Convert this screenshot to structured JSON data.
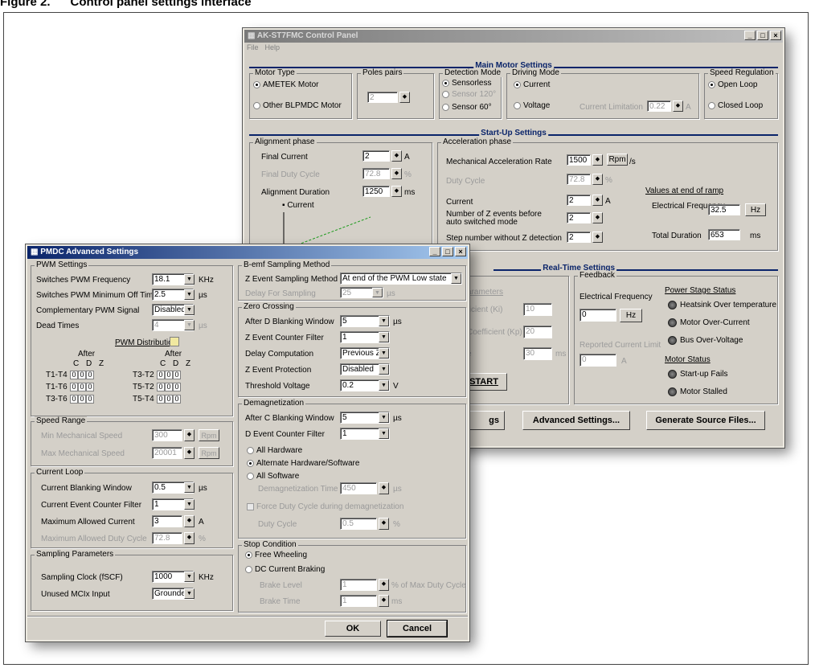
{
  "figure": {
    "caption": "Figure 2.      Control panel settings interface"
  },
  "cp": {
    "title": "AK-ST7FMC Control Panel",
    "menu": [
      "File",
      "Help"
    ],
    "main": {
      "title": "Main Motor Settings",
      "motor_type": {
        "legend": "Motor Type",
        "opt1": "AMETEK Motor",
        "opt2": "Other BLPMDC Motor"
      },
      "poles": {
        "legend": "Poles pairs",
        "value": "2"
      },
      "detection": {
        "legend": "Detection Mode",
        "opt1": "Sensorless",
        "opt2": "Sensor 120°",
        "opt3": "Sensor 60°"
      },
      "driving": {
        "legend": "Driving Mode",
        "opt1": "Current",
        "opt2": "Voltage",
        "limit_label": "Current Limitation",
        "limit_value": "0.22",
        "limit_unit": "A"
      },
      "speed": {
        "legend": "Speed Regulation",
        "opt1": "Open Loop",
        "opt2": "Closed Loop"
      }
    },
    "startup": {
      "title": "Start-Up Settings",
      "align": {
        "legend": "Alignment phase",
        "final_current_label": "Final Current",
        "final_current_value": "2",
        "final_current_unit": "A",
        "final_duty_label": "Final Duty Cycle",
        "final_duty_value": "72.8",
        "final_duty_unit": "%",
        "duration_label": "Alignment Duration",
        "duration_value": "1250",
        "duration_unit": "ms",
        "graph_label": "Current"
      },
      "accel": {
        "legend": "Acceleration phase",
        "rate_label": "Mechanical Acceleration Rate",
        "rate_value": "1500",
        "rate_unit_btn": "Rpm",
        "rate_unit_suffix": "/s",
        "duty_label": "Duty Cycle",
        "duty_value": "72.8",
        "duty_unit": "%",
        "current_label": "Current",
        "current_value": "2",
        "current_unit": "A",
        "z_events_label": "Number of Z events before auto switched mode",
        "z_events_value": "2",
        "step_label": "Step number without Z detection",
        "step_value": "2",
        "end_title": "Values at end of ramp",
        "freq_label": "Electrical Frequency",
        "freq_value": "32.5",
        "freq_unit": "Hz",
        "dur_label": "Total Duration",
        "dur_value": "653",
        "dur_unit": "ms"
      }
    },
    "realtime": {
      "title": "Real-Time Settings",
      "params_label": "arameters",
      "ki_label": "ficient (Ki)",
      "ki_value": "10",
      "kp_label": "Coefficient (Kp)",
      "kp_value": "20",
      "x_label": "e",
      "x_value": "30",
      "x_unit": "ms",
      "start": "START",
      "feedback": {
        "legend": "Feedback",
        "freq_label": "Electrical Frequency",
        "freq_value": "0",
        "freq_unit": "Hz",
        "limit_label": "Reported Current Limit",
        "limit_value": "0",
        "limit_unit": "A",
        "ps_title": "Power Stage Status",
        "ps": [
          "Heatsink Over temperature",
          "Motor Over-Current",
          "Bus Over-Voltage"
        ],
        "ms_title": "Motor Status",
        "ms": [
          "Start-up Fails",
          "Motor Stalled"
        ]
      }
    },
    "buttons": [
      "gs",
      "Advanced Settings...",
      "Generate Source Files..."
    ]
  },
  "adv": {
    "title": "PMDC Advanced Settings",
    "pwm": {
      "legend": "PWM Settings",
      "freq_label": "Switches PWM Frequency",
      "freq_value": "18.1",
      "freq_unit": "KHz",
      "offtime_label": "Switches PWM Minimum Off Time",
      "offtime_value": "2.5",
      "offtime_unit": "µs",
      "comp_label": "Complementary PWM Signal",
      "comp_value": "Disabled",
      "dead_label": "Dead Times",
      "dead_value": "4",
      "dead_unit": "µs",
      "dist_title": "PWM Distribution",
      "after": "After",
      "cdz": "C D Z",
      "rows_left": [
        "T1-T4",
        "T1-T6",
        "T3-T6"
      ],
      "rows_right": [
        "T3-T2",
        "T5-T2",
        "T5-T4"
      ]
    },
    "speed": {
      "legend": "Speed Range",
      "min_label": "Min Mechanical Speed",
      "min_value": "300",
      "max_label": "Max Mechanical Speed",
      "max_value": "20001",
      "unit": "Rpm"
    },
    "cloop": {
      "legend": "Current Loop",
      "blank_label": "Current Blanking Window",
      "blank_value": "0.5",
      "blank_unit": "µs",
      "filter_label": "Current Event Counter Filter",
      "filter_value": "1",
      "max_label": "Maximum Allowed Current",
      "max_value": "3",
      "max_unit": "A",
      "duty_label": "Maximum Allowed Duty Cycle",
      "duty_value": "72.8",
      "duty_unit": "%"
    },
    "sampling": {
      "legend": "Sampling Parameters",
      "clock_label": "Sampling Clock (fSCF)",
      "clock_value": "1000",
      "clock_unit": "KHz",
      "mcix_label": "Unused MCIx Input",
      "mcix_value": "Grounded"
    },
    "bemf": {
      "legend": "B-emf Sampling Method",
      "method_label": "Z Event Sampling Method",
      "method_value": "At end of the PWM Low state",
      "delay_label": "Delay For Sampling",
      "delay_value": "25",
      "delay_unit": "µs"
    },
    "zc": {
      "legend": "Zero Crossing",
      "blank_label": "After D Blanking Window",
      "blank_value": "5",
      "blank_unit": "µs",
      "filter_label": "Z Event Counter Filter",
      "filter_value": "1",
      "delay_label": "Delay Computation",
      "delay_value": "Previous Z",
      "prot_label": "Z Event Protection",
      "prot_value": "Disabled",
      "thresh_label": "Threshold Voltage",
      "thresh_value": "0.2",
      "thresh_unit": "V"
    },
    "demag": {
      "legend": "Demagnetization",
      "blank_label": "After C Blanking Window",
      "blank_value": "5",
      "blank_unit": "µs",
      "filter_label": "D Event Counter Filter",
      "filter_value": "1",
      "opt1": "All Hardware",
      "opt2": "Alternate Hardware/Software",
      "opt3": "All Software",
      "time_label": "Demagnetization Time",
      "time_value": "450",
      "time_unit": "µs",
      "force_label": "Force Duty Cycle during demagnetization",
      "duty_label": "Duty Cycle",
      "duty_value": "0.5",
      "duty_unit": "%"
    },
    "stop": {
      "legend": "Stop Condition",
      "opt1": "Free Wheeling",
      "opt2": "DC Current Braking",
      "level_label": "Brake Level",
      "level_value": "1",
      "level_unit": "% of Max Duty Cycle",
      "time_label": "Brake Time",
      "time_value": "1",
      "time_unit": "ms"
    },
    "ok": "OK",
    "cancel": "Cancel"
  }
}
